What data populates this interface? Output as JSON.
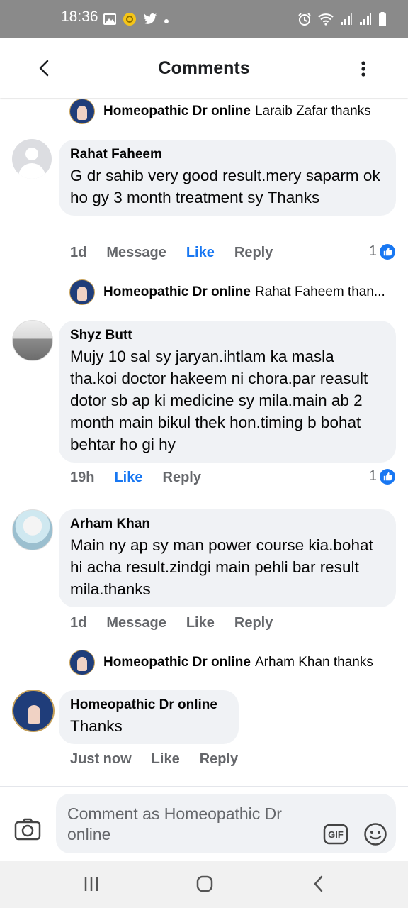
{
  "status_bar": {
    "time": "18:36",
    "left_icons": [
      "gallery-icon",
      "notification-badge-icon",
      "twitter-icon",
      "dot-icon"
    ],
    "right_icons": [
      "alarm-icon",
      "wifi-icon",
      "signal-icon",
      "signal-icon",
      "battery-icon"
    ]
  },
  "header": {
    "title": "Comments"
  },
  "comments": [
    {
      "reply": {
        "page_name": "Homeopathic Dr online",
        "text": "Laraib Zafar thanks"
      }
    },
    {
      "author": "Rahat Faheem",
      "text": "G dr sahib very good result.mery saparm ok ho gy 3 month treatment sy Thanks",
      "time": "1d",
      "actions": [
        "Message",
        "Like",
        "Reply"
      ],
      "liked": true,
      "reactions": "1",
      "reply": {
        "page_name": "Homeopathic Dr online",
        "text": "Rahat Faheem than..."
      }
    },
    {
      "author": "Shyz Butt",
      "text": "Mujy 10 sal sy jaryan.ihtlam ka masla tha.koi doctor hakeem ni chora.par reasult dotor sb ap ki medicine sy mila.main ab 2 month main bikul thek hon.timing b bohat behtar ho gi hy",
      "time": "19h",
      "actions": [
        "Like",
        "Reply"
      ],
      "liked": true,
      "reactions": "1"
    },
    {
      "author": "Arham Khan",
      "text": "Main ny ap sy man power course kia.bohat hi acha result.zindgi main pehli bar result mila.thanks",
      "time": "1d",
      "actions": [
        "Message",
        "Like",
        "Reply"
      ],
      "liked": false,
      "reply": {
        "page_name": "Homeopathic Dr online",
        "text": "Arham Khan thanks"
      }
    },
    {
      "author": "Homeopathic Dr online",
      "text": "Thanks",
      "time": "Just now",
      "actions": [
        "Like",
        "Reply"
      ],
      "liked": false
    }
  ],
  "composer": {
    "placeholder": "Comment as Homeopathic Dr online",
    "gif_label": "GIF"
  },
  "colors": {
    "like_blue": "#1877f2",
    "bubble_bg": "#f0f2f5",
    "meta_gray": "#65676b",
    "status_bar": "#8a8a8a"
  }
}
